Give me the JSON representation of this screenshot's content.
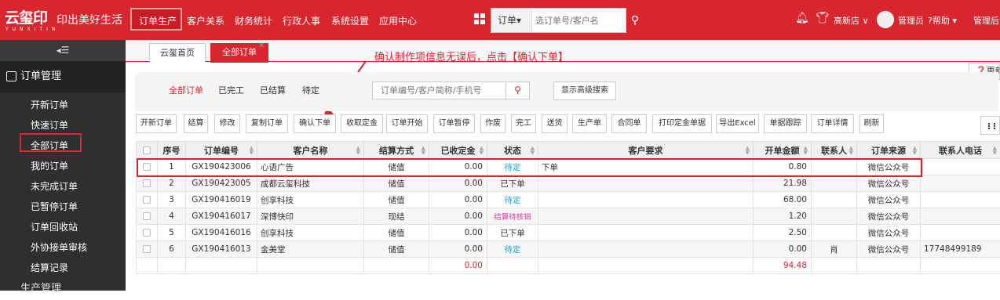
{
  "header": {
    "logo_text": "云玺印",
    "logo_sub": "YUNXITIN",
    "slogan": "印出美好生活",
    "nav": [
      "订单生产",
      "客户关系",
      "财务统计",
      "行政人事",
      "系统设置",
      "应用中心"
    ],
    "search_type": "订单",
    "search_placeholder": "选订单号/客户名",
    "store": "高新店",
    "user": "管理员",
    "help": "帮助",
    "admin_back": "管理后台"
  },
  "sidebar": {
    "collapse_icon": "◂☰",
    "group": "订单管理",
    "items": [
      "开新订单",
      "快速订单",
      "全部订单",
      "我的订单",
      "未完成订单",
      "已暂停订单",
      "订单回收站",
      "外协接单审核",
      "结算记录"
    ],
    "group2": "生产管理"
  },
  "tabs": {
    "home": "云玺首页",
    "all": "全部订单",
    "close": "✕"
  },
  "annotation": "确认制作项信息无误后，点击【确认下单】",
  "update_btn": "更新",
  "subtabs": [
    "全部订单",
    "已完工",
    "已结算",
    "待定"
  ],
  "filter": {
    "placeholder": "订单编号/客户简称/手机号",
    "advanced": "显示高级搜索"
  },
  "toolbar": [
    "开新订单",
    "结算",
    "修改",
    "复制订单",
    "确认下单",
    "收取定金",
    "订单开始",
    "订单暂停",
    "作废",
    "完工",
    "送货",
    "生产单",
    "合同单",
    "打印定金单据",
    "导出Excel",
    "单据跟踪",
    "订单详情",
    "刷新"
  ],
  "table": {
    "headers": [
      "",
      "序号",
      "订单编号",
      "客户名称",
      "结算方式",
      "已收定金",
      "状态",
      "客户要求",
      "开单金额",
      "联系人",
      "订单来源",
      "联系人电话"
    ],
    "rows": [
      [
        "1",
        "GX190423006",
        "心语广告",
        "储值",
        "0.00",
        "待定",
        "下单",
        "0.80",
        "",
        "微信公众号",
        ""
      ],
      [
        "2",
        "GX190423005",
        "成都云玺科技",
        "储值",
        "0.00",
        "已下单",
        "",
        "21.98",
        "",
        "微信公众号",
        ""
      ],
      [
        "3",
        "GX190416019",
        "创享科技",
        "储值",
        "0.00",
        "待定",
        "",
        "68.00",
        "",
        "微信公众号",
        ""
      ],
      [
        "4",
        "GX190416017",
        "深博快印",
        "现结",
        "0.00",
        "结算待核销",
        "",
        "1.20",
        "",
        "微信公众号",
        ""
      ],
      [
        "5",
        "GX190416016",
        "创享科技",
        "储值",
        "0.00",
        "已下单",
        "",
        "2.50",
        "",
        "微信公众号",
        ""
      ],
      [
        "6",
        "GX190416013",
        "金美堂",
        "储值",
        "0.00",
        "待定",
        "",
        "0.00",
        "肖",
        "微信公众号",
        "17748499189"
      ]
    ],
    "totals": {
      "deposit": "0.00",
      "amount": "94.48"
    }
  },
  "colors": {
    "brand": "#d7262e",
    "status_pending": "#1aa3d8",
    "status_settle": "#e23ba8",
    "total_red": "#d7262e"
  }
}
